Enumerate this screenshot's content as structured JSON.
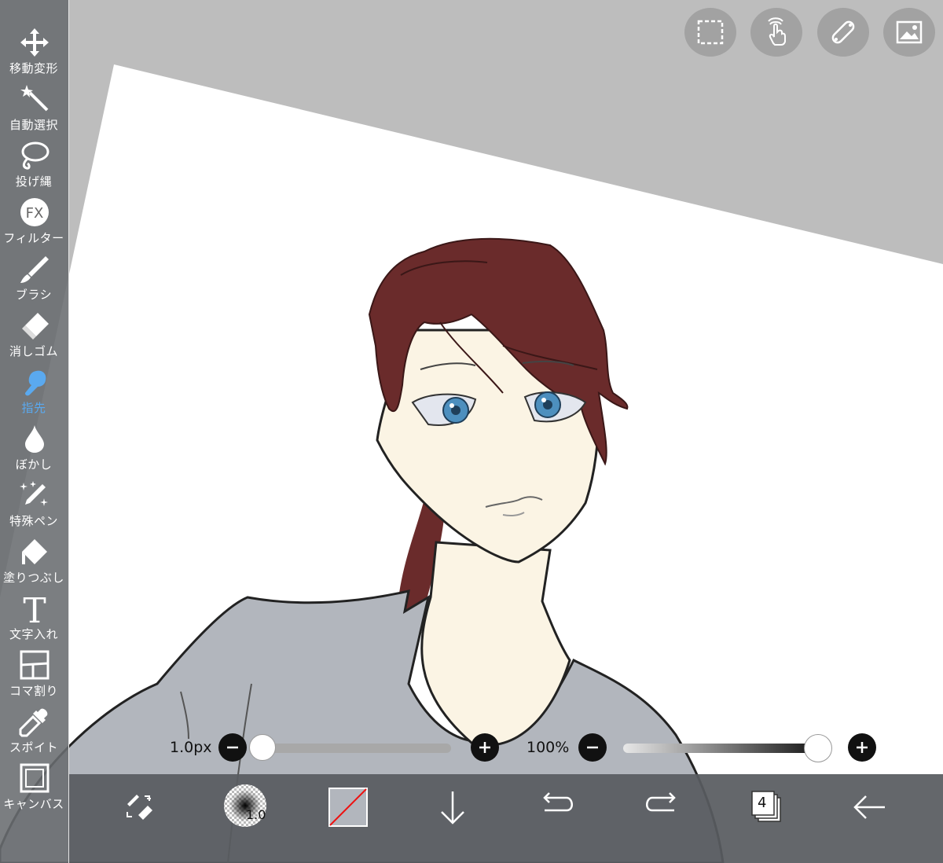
{
  "toolbar": {
    "items": [
      {
        "id": "move",
        "label": "移動変形",
        "icon": "move-arrows-icon"
      },
      {
        "id": "magic",
        "label": "自動選択",
        "icon": "magic-wand-icon"
      },
      {
        "id": "lasso",
        "label": "投げ縄",
        "icon": "lasso-icon"
      },
      {
        "id": "filter",
        "label": "フィルター",
        "icon": "fx-icon"
      },
      {
        "id": "brush",
        "label": "ブラシ",
        "icon": "brush-icon"
      },
      {
        "id": "eraser",
        "label": "消しゴム",
        "icon": "eraser-icon"
      },
      {
        "id": "finger",
        "label": "指先",
        "icon": "finger-smudge-icon",
        "active": true
      },
      {
        "id": "blur",
        "label": "ぼかし",
        "icon": "blur-drop-icon"
      },
      {
        "id": "special",
        "label": "特殊ペン",
        "icon": "special-pen-icon"
      },
      {
        "id": "fill",
        "label": "塗りつぶし",
        "icon": "paint-bucket-icon"
      },
      {
        "id": "text",
        "label": "文字入れ",
        "icon": "text-t-icon"
      },
      {
        "id": "frame",
        "label": "コマ割り",
        "icon": "frame-divider-icon"
      },
      {
        "id": "eyedropper",
        "label": "スポイト",
        "icon": "eyedropper-icon"
      },
      {
        "id": "canvas",
        "label": "キャンバス",
        "icon": "canvas-icon"
      }
    ],
    "active_color": "#5aa9ef"
  },
  "top_buttons": [
    {
      "id": "selection",
      "icon": "selection-rect-icon"
    },
    {
      "id": "gesture",
      "icon": "touch-gesture-icon"
    },
    {
      "id": "ruler",
      "icon": "ruler-icon"
    },
    {
      "id": "material",
      "icon": "image-material-icon"
    }
  ],
  "brush_size": {
    "value_label": "1.0px",
    "level": 0.0
  },
  "opacity": {
    "value_label": "100%",
    "level": 1.0
  },
  "bottom_bar": {
    "brush_preview_label": "1.0",
    "layer_count": "4",
    "items": [
      {
        "id": "pen-eraser-toggle",
        "icon": "pen-eraser-swap-icon"
      },
      {
        "id": "brush-size-preview",
        "icon": "brush-preview-icon"
      },
      {
        "id": "color",
        "icon": "color-swatch-icon"
      },
      {
        "id": "download",
        "icon": "down-arrow-icon"
      },
      {
        "id": "undo",
        "icon": "undo-icon"
      },
      {
        "id": "redo",
        "icon": "redo-icon"
      },
      {
        "id": "layers",
        "icon": "layers-icon"
      },
      {
        "id": "back",
        "icon": "back-arrow-icon"
      }
    ]
  },
  "colors": {
    "hair": "#6a2b2b",
    "skin": "#fbf4e4",
    "shirt": "#b2b6bd",
    "eyes": "#4d8fbe",
    "canvas_bg": "#bdbdbd",
    "sidebar": "#696c70"
  }
}
